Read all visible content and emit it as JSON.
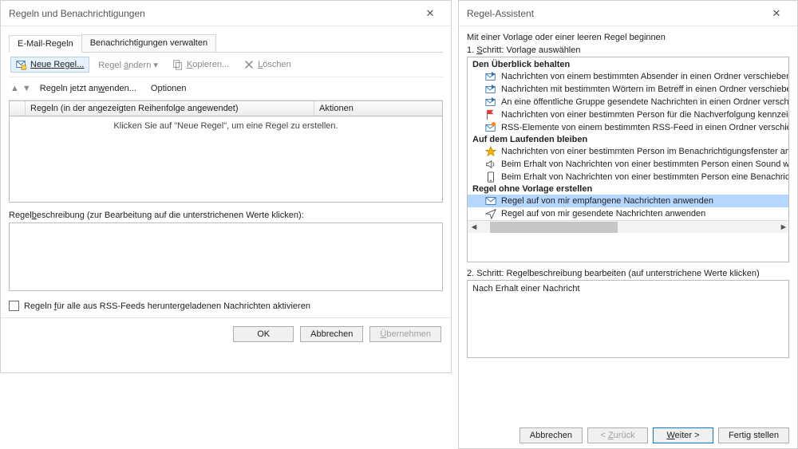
{
  "left": {
    "title": "Regeln und Benachrichtigungen",
    "tabs": {
      "email": "E-Mail-Regeln",
      "notif": "Benachrichtigungen verwalten"
    },
    "toolbar": {
      "new": "Neue Regel...",
      "edit": "Regel ändern",
      "copy": "Kopieren...",
      "delete": "Löschen",
      "applyNow": "Regeln jetzt anwenden...",
      "options": "Optionen"
    },
    "cols": {
      "rules": "Regeln (in der angezeigten Reihenfolge angewendet)",
      "actions": "Aktionen"
    },
    "emptyHint": "Klicken Sie auf \"Neue Regel\", um eine Regel zu erstellen.",
    "descLabel": "Regelbeschreibung (zur Bearbeitung auf die unterstrichenen Werte klicken):",
    "rssCheck": "Regeln für alle aus RSS-Feeds heruntergeladenen Nachrichten aktivieren",
    "buttons": {
      "ok": "OK",
      "cancel": "Abbrechen",
      "apply": "Übernehmen"
    }
  },
  "right": {
    "title": "Regel-Assistent",
    "intro": "Mit einer Vorlage oder einer leeren Regel beginnen",
    "step1": "1. Schritt: Vorlage auswählen",
    "groups": {
      "overview": "Den Überblick behalten",
      "updated": "Auf dem Laufenden bleiben",
      "blank": "Regel ohne Vorlage erstellen"
    },
    "items": {
      "ov1": "Nachrichten von einem bestimmten Absender in einen Ordner verschieben",
      "ov2": "Nachrichten mit bestimmten Wörtern im Betreff in einen Ordner verschieben",
      "ov3": "An eine öffentliche Gruppe gesendete Nachrichten in einen Ordner verschieben",
      "ov4": "Nachrichten von einer bestimmten Person für die Nachverfolgung kennzeichnen",
      "ov5": "RSS-Elemente von einem bestimmten RSS-Feed in einen Ordner verschieben",
      "up1": "Nachrichten von einer bestimmten Person im Benachrichtigungsfenster anzeigen",
      "up2": "Beim Erhalt von Nachrichten von einer bestimmten Person einen Sound wiedergeben",
      "up3": "Beim Erhalt von Nachrichten von einer bestimmten Person eine Benachrichtigung senden",
      "bl1": "Regel auf von mir empfangene Nachrichten anwenden",
      "bl2": "Regel auf von mir gesendete Nachrichten anwenden"
    },
    "step2": "2. Schritt: Regelbeschreibung bearbeiten (auf unterstrichene Werte klicken)",
    "desc": "Nach Erhalt einer Nachricht",
    "buttons": {
      "cancel": "Abbrechen",
      "back": "< Zurück",
      "next": "Weiter >",
      "finish": "Fertig stellen"
    }
  }
}
